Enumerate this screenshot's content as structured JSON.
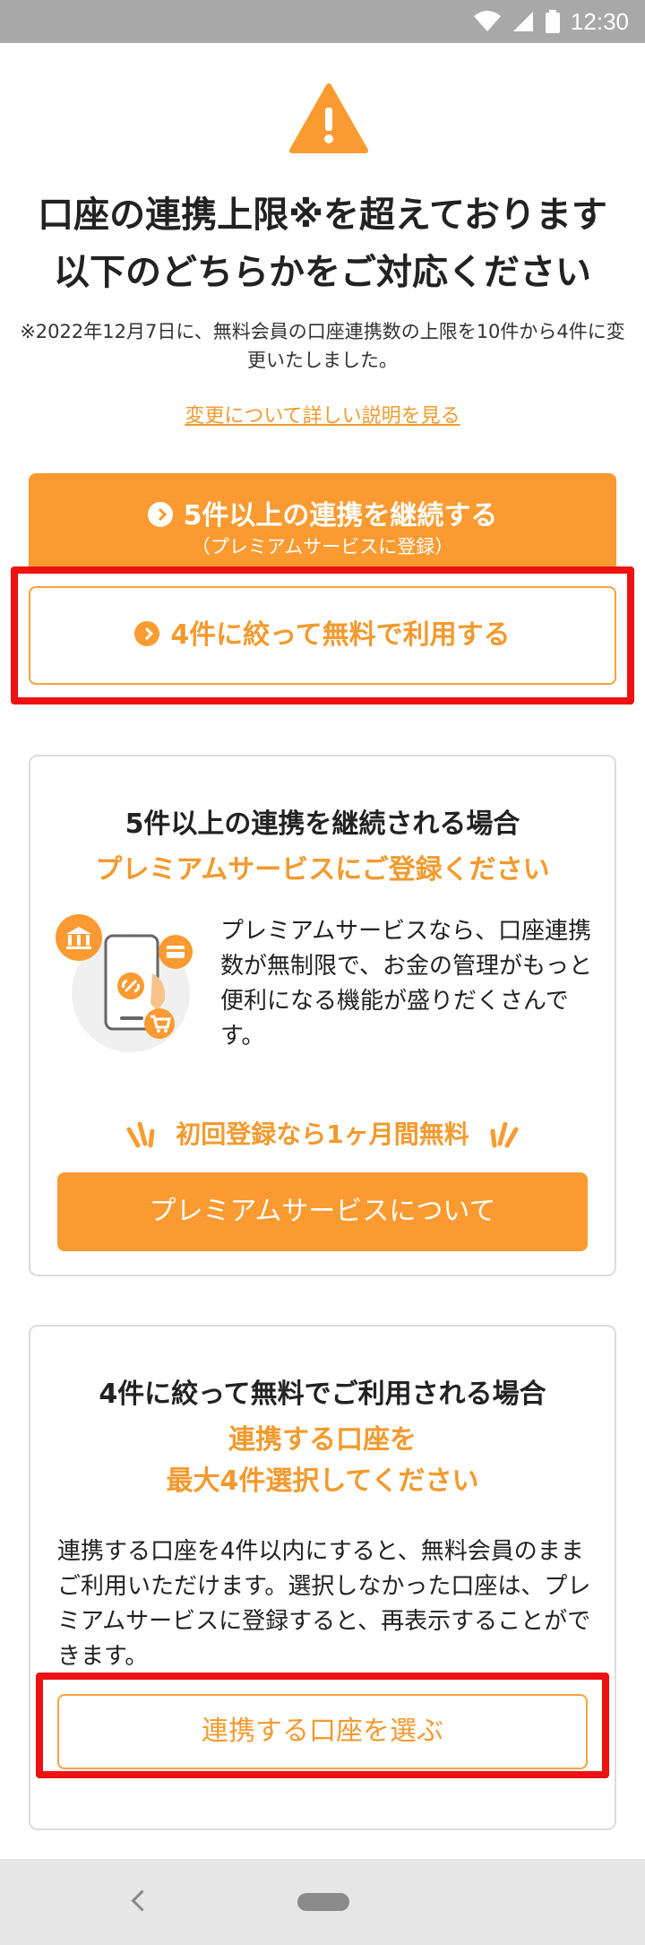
{
  "status_bar": {
    "time": "12:30"
  },
  "header": {
    "title_line1": "口座の連携上限※を超えております",
    "title_line2": "以下のどちらかをご対応ください",
    "note": "※2022年12月7日に、無料会員の口座連携数の上限を10件から4件に変更いたしました。",
    "detail_link": "変更について詳しい説明を見る"
  },
  "actions": {
    "continue_label": "5件以上の連携を継続する",
    "continue_sub": "（プレミアムサービスに登録）",
    "free_label": "4件に絞って無料で利用する"
  },
  "premium_card": {
    "title": "5件以上の連携を継続される場合",
    "subtitle": "プレミアムサービスにご登録ください",
    "description": "プレミアムサービスなら、口座連携数が無制限で、お金の管理がもっと便利になる機能が盛りだくさんです。",
    "promo": "初回登録なら1ヶ月間無料",
    "button": "プレミアムサービスについて"
  },
  "free_card": {
    "title": "4件に絞って無料でご利用される場合",
    "subtitle_line1": "連携する口座を",
    "subtitle_line2": "最大4件選択してください",
    "description": "連携する口座を4件以内にすると、無料会員のままご利用いただけます。選択しなかった口座は、プレミアムサービスに登録すると、再表示することができます。",
    "button": "連携する口座を選ぶ"
  },
  "colors": {
    "accent": "#fb9a30",
    "highlight": "#ee1111"
  }
}
